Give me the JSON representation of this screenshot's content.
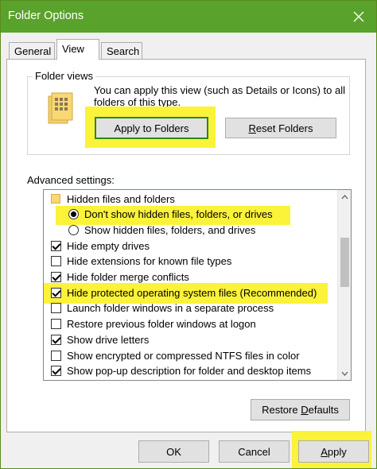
{
  "window": {
    "title": "Folder Options",
    "close_icon": "close-icon"
  },
  "tabs": [
    {
      "label": "General",
      "active": false
    },
    {
      "label": "View",
      "active": true
    },
    {
      "label": "Search",
      "active": false
    }
  ],
  "folder_views": {
    "legend": "Folder views",
    "description": "You can apply this view (such as Details or Icons) to all folders of this type.",
    "icon": "folder-views-icon",
    "apply_button": "Apply to Folders",
    "reset_button_pre": "",
    "reset_button_u": "R",
    "reset_button_post": "eset Folders"
  },
  "advanced": {
    "label": "Advanced settings:",
    "items": [
      {
        "type": "folder",
        "label": "Hidden files and folders",
        "indent": 0
      },
      {
        "type": "radio",
        "label": "Don't show hidden files, folders, or drives",
        "checked": true,
        "indent": 1
      },
      {
        "type": "radio",
        "label": "Show hidden files, folders, and drives",
        "checked": false,
        "indent": 1
      },
      {
        "type": "checkbox",
        "label": "Hide empty drives",
        "checked": true,
        "indent": 0
      },
      {
        "type": "checkbox",
        "label": "Hide extensions for known file types",
        "checked": false,
        "indent": 0
      },
      {
        "type": "checkbox",
        "label": "Hide folder merge conflicts",
        "checked": true,
        "indent": 0
      },
      {
        "type": "checkbox",
        "label": "Hide protected operating system files (Recommended)",
        "checked": true,
        "indent": 0
      },
      {
        "type": "checkbox",
        "label": "Launch folder windows in a separate process",
        "checked": false,
        "indent": 0
      },
      {
        "type": "checkbox",
        "label": "Restore previous folder windows at logon",
        "checked": false,
        "indent": 0
      },
      {
        "type": "checkbox",
        "label": "Show drive letters",
        "checked": true,
        "indent": 0
      },
      {
        "type": "checkbox",
        "label": "Show encrypted or compressed NTFS files in color",
        "checked": false,
        "indent": 0
      },
      {
        "type": "checkbox",
        "label": "Show pop-up description for folder and desktop items",
        "checked": true,
        "indent": 0
      }
    ],
    "restore_pre": "Restore ",
    "restore_u": "D",
    "restore_post": "efaults"
  },
  "footer": {
    "ok": "OK",
    "cancel": "Cancel",
    "apply_u": "A",
    "apply_post": "pply"
  },
  "colors": {
    "titlebar": "#59a22b",
    "highlight": "#fbf23a",
    "highlight_border": "#2b8a14"
  }
}
